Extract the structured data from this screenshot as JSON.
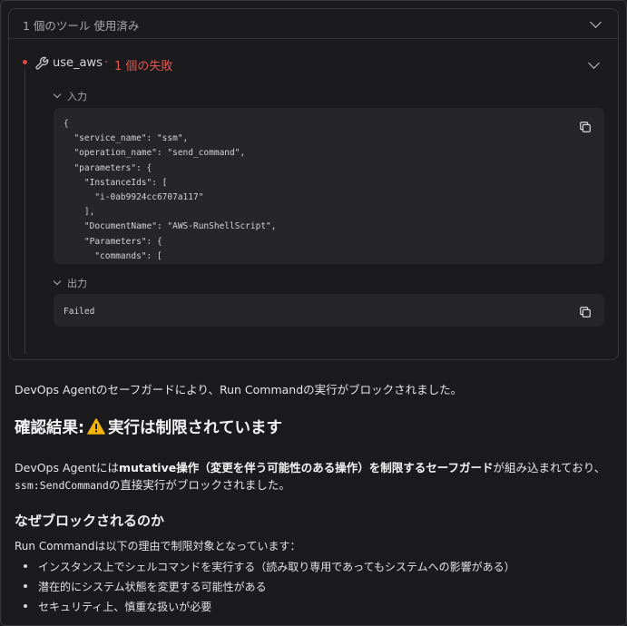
{
  "tool_panel": {
    "summary": "1 個のツール 使用済み",
    "tool_name": "use_aws",
    "separator": "·",
    "fail_status": "1 個の失敗",
    "input_label": "入力",
    "input_code": "{\n  \"service_name\": \"ssm\",\n  \"operation_name\": \"send_command\",\n  \"parameters\": {\n    \"InstanceIds\": [\n      \"i-0ab9924cc6707a117\"\n    ],\n    \"DocumentName\": \"AWS-RunShellScript\",\n    \"Parameters\": {\n      \"commands\": [",
    "output_label": "出力",
    "output_text": "Failed",
    "icons": {
      "header_toggle": "chevron-down-icon",
      "row_toggle": "chevron-down-icon",
      "tool": "wrench-icon",
      "status": "error-dot-icon",
      "copy": "copy-icon"
    },
    "colors": {
      "error": "#e0574f"
    }
  },
  "message": {
    "intro": "DevOps Agentのセーフガードにより、Run Commandの実行がブロックされました。",
    "heading_prefix": "確認結果:",
    "heading_icon": "warning-icon",
    "heading_suffix": "実行は制限されています",
    "para_part1": "DevOps Agentには",
    "para_bold": "mutative操作（変更を伴う可能性のある操作）を制限するセーフガード",
    "para_part2": "が組み込まれており、",
    "para_code": "ssm:SendCommand",
    "para_part3": "の直接実行がブロックされました。",
    "subheading": "なぜブロックされるのか",
    "reason_intro": "Run Commandは以下の理由で制限対象となっています：",
    "reasons": [
      "インスタンス上でシェルコマンドを実行する（読み取り専用であってもシステムへの影響がある）",
      "潜在的にシステム状態を変更する可能性がある",
      "セキュリティ上、慎重な扱いが必要"
    ]
  }
}
